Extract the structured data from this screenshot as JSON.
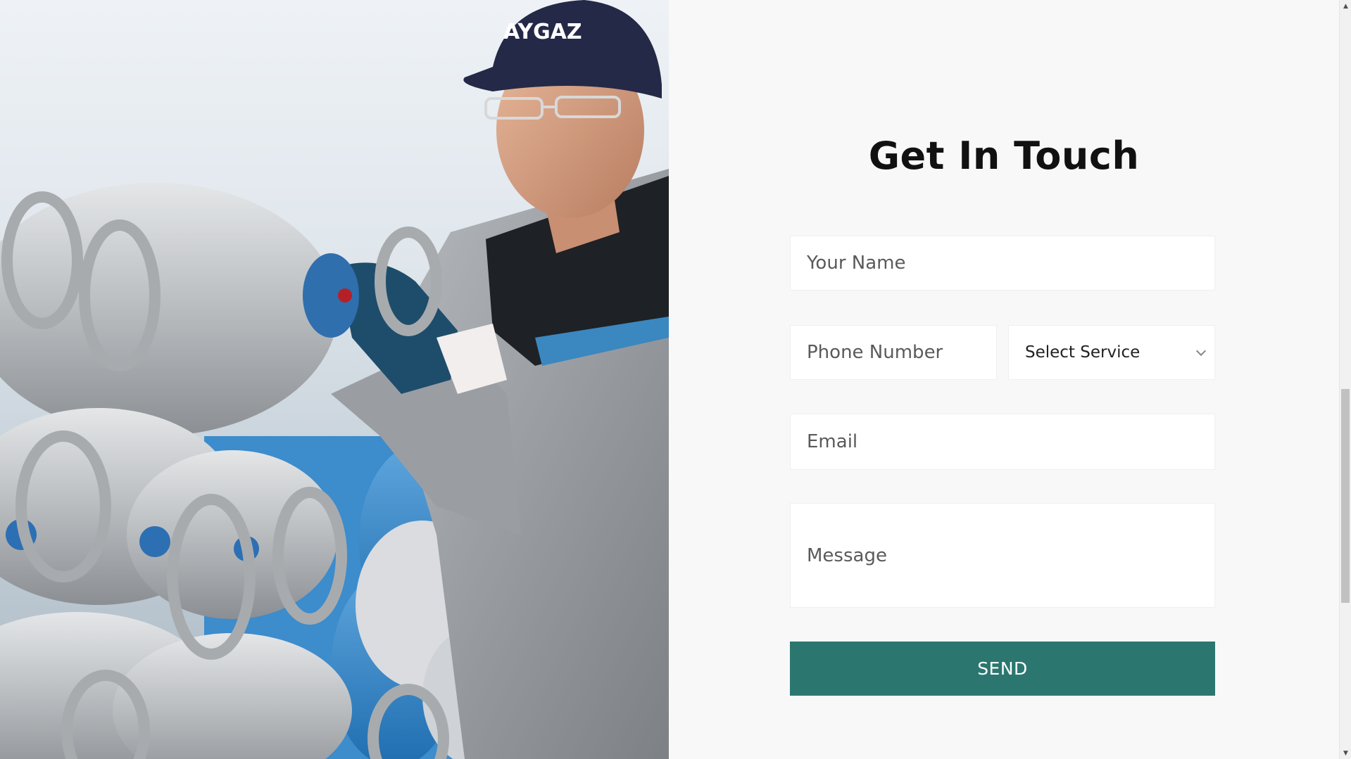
{
  "form": {
    "title": "Get In Touch",
    "name_placeholder": "Your Name",
    "phone_placeholder": "Phone Number",
    "service_selected": "Select Service",
    "email_placeholder": "Email",
    "message_placeholder": "Message",
    "send_label": "SEND"
  },
  "photo": {
    "cap_logo": "AYGAZ"
  },
  "colors": {
    "accent": "#2b7770",
    "background": "#f8f8f8",
    "field": "#ffffff",
    "title": "#111111"
  },
  "icons": {
    "select_arrow": "chevron-down-icon",
    "scroll_up": "scroll-up-arrow-icon",
    "scroll_down": "scroll-down-arrow-icon"
  }
}
